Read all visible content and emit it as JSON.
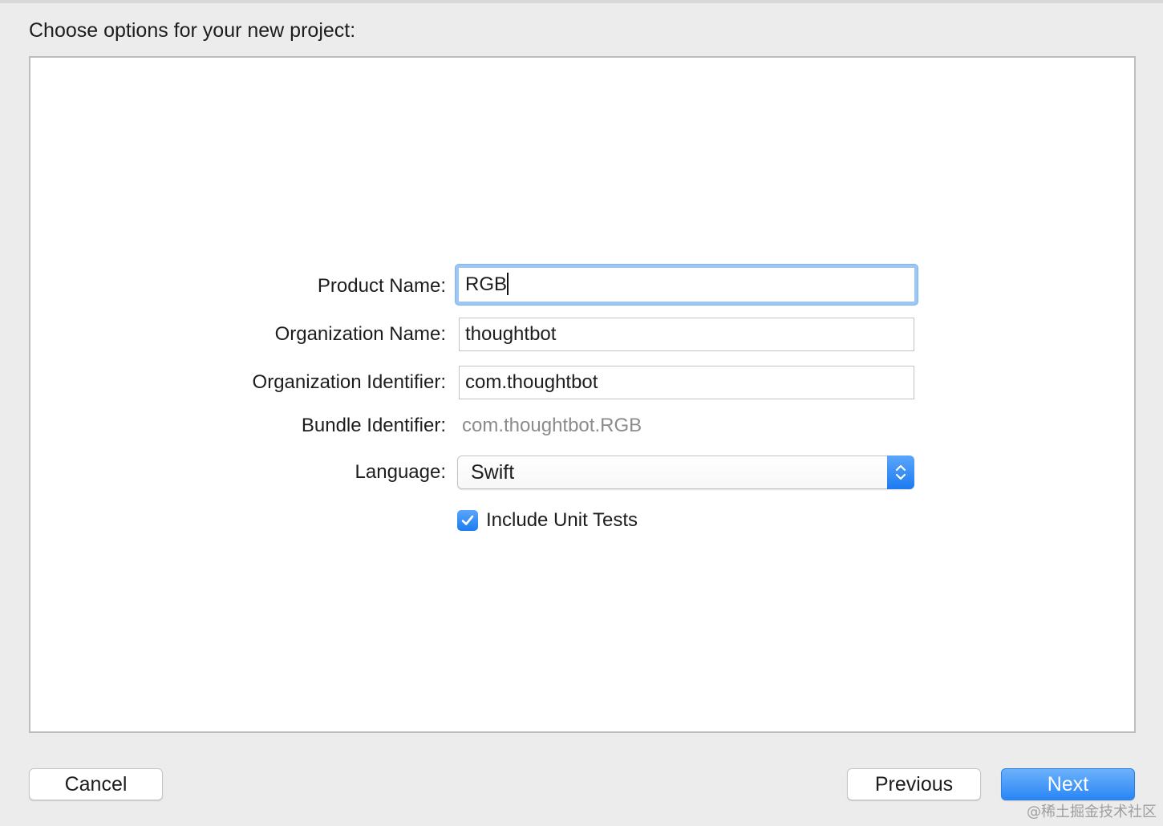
{
  "header": {
    "title": "Choose options for your new project:"
  },
  "form": {
    "product_name": {
      "label": "Product Name:",
      "value": "RGB"
    },
    "organization_name": {
      "label": "Organization Name:",
      "value": "thoughtbot"
    },
    "organization_identifier": {
      "label": "Organization Identifier:",
      "value": "com.thoughtbot"
    },
    "bundle_identifier": {
      "label": "Bundle Identifier:",
      "value": "com.thoughtbot.RGB"
    },
    "language": {
      "label": "Language:",
      "selected": "Swift"
    },
    "include_unit_tests": {
      "label": "Include Unit Tests",
      "checked": true
    }
  },
  "footer": {
    "cancel_label": "Cancel",
    "previous_label": "Previous",
    "next_label": "Next"
  },
  "watermark": "@稀土掘金技术社区",
  "colors": {
    "accent": "#1c7bf2",
    "focus_ring": "#9cc6f5",
    "background": "#ececec",
    "panel": "#ffffff",
    "muted_text": "#8b8b8b"
  },
  "icons": {
    "language_stepper": "chevron-up-down-icon",
    "checkbox_check": "checkmark-icon"
  }
}
